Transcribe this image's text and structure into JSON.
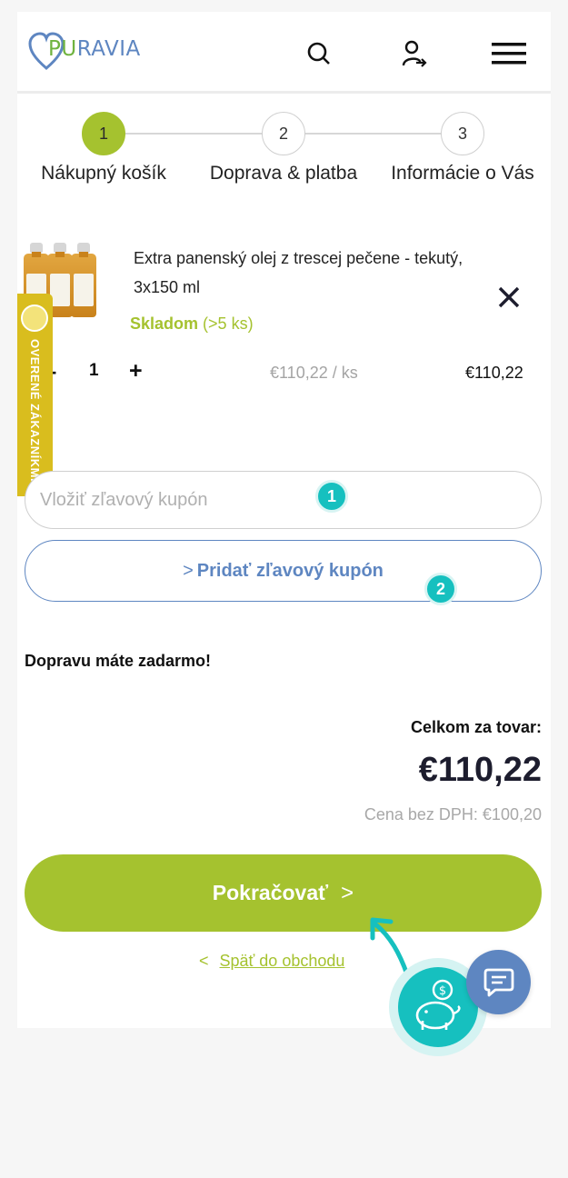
{
  "header": {
    "logo_text_accent": "PU",
    "logo_text": "RAVIA",
    "icons": [
      "search-icon",
      "user-login-icon",
      "menu-icon"
    ]
  },
  "steps": [
    {
      "number": "1",
      "label": "Nákupný košík",
      "active": true
    },
    {
      "number": "2",
      "label": "Doprava & platba",
      "active": false
    },
    {
      "number": "3",
      "label": "Informácie o Vás",
      "active": false
    }
  ],
  "cart": {
    "item": {
      "name": "Extra panenský olej z trescej pečene - tekutý, 3x150 ml",
      "stock_status": "Skladom",
      "stock_count": "(>5 ks)",
      "quantity": "1",
      "qty_minus": "-",
      "qty_plus": "+",
      "unit_price": "€110,22 / ks",
      "total": "€110,22",
      "remove_label": "✕"
    }
  },
  "trust_badge": {
    "label": "OVERENÉ ZÁKAZNÍKMI"
  },
  "coupon": {
    "placeholder": "Vložiť zľavový kupón",
    "button_chevron": ">",
    "button_label": "Pridať zľavový kupón",
    "marker_1": "1",
    "marker_2": "2"
  },
  "summary": {
    "free_shipping": "Dopravu máte zadarmo!",
    "total_label": "Celkom za tovar:",
    "total_value": "€110,22",
    "net_price": "Cena bez DPH:  €100,20"
  },
  "actions": {
    "continue_label": "Pokračovať",
    "continue_arrow": ">",
    "back_chevron": "<",
    "back_label": "Späť do obchodu"
  },
  "colors": {
    "brand_green": "#a5c22f",
    "brand_blue": "#5e86c1",
    "marker_teal": "#16c0bf"
  }
}
